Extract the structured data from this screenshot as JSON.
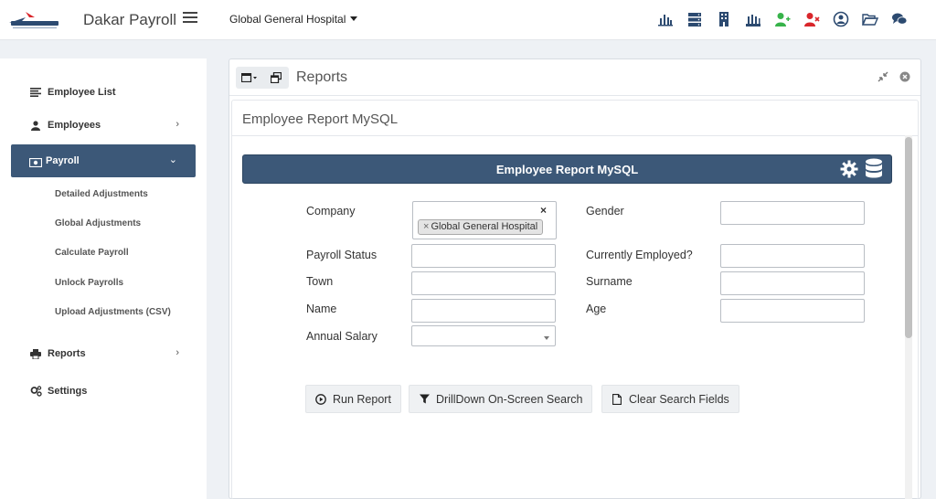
{
  "app": {
    "brand": "Dakar Payroll",
    "company": "Global General Hospital"
  },
  "top_icons": [
    "bar-chart-icon",
    "server-icon",
    "building-icon",
    "industry-icon",
    "user-plus-icon",
    "user-remove-icon",
    "user-circle-icon",
    "folder-open-icon",
    "comments-icon"
  ],
  "colors": {
    "accent": "#3c5878",
    "add_user": "#37b34a",
    "remove_user": "#d9262b",
    "icon": "#2c4a70"
  },
  "sidebar": {
    "employee_list": "Employee List",
    "employees": "Employees",
    "payroll": "Payroll",
    "payroll_sub": [
      "Detailed Adjustments",
      "Global Adjustments",
      "Calculate Payroll",
      "Unlock Payrolls",
      "Upload Adjustments (CSV)"
    ],
    "reports": "Reports",
    "settings": "Settings"
  },
  "panel": {
    "title": "Reports",
    "inner_title": "Employee Report MySQL",
    "report_bar_title": "Employee Report MySQL"
  },
  "form": {
    "company_label": "Company",
    "company_chip": "Global General Hospital",
    "company_clear": "×",
    "chip_remove": "×",
    "gender_label": "Gender",
    "payroll_status_label": "Payroll Status",
    "currently_employed_label": "Currently Employed?",
    "town_label": "Town",
    "surname_label": "Surname",
    "name_label": "Name",
    "age_label": "Age",
    "annual_salary_label": "Annual Salary"
  },
  "buttons": {
    "run_report": "Run Report",
    "drilldown": "DrillDown On-Screen Search",
    "clear": "Clear Search Fields"
  }
}
